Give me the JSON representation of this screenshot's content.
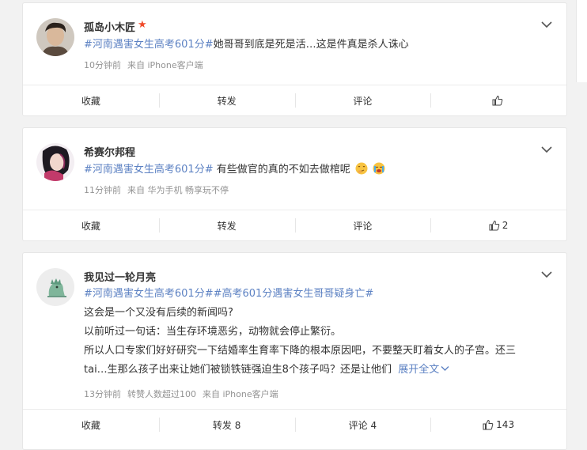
{
  "posts": [
    {
      "username": "孤岛小木匠",
      "text_tag": "#河南遇害女生高考601分#",
      "text_rest": "她哥哥到底是死是活…这是件真是杀人诛心",
      "time": "10分钟前",
      "source": "来自 iPhone客户端",
      "actions": {
        "collect": "收藏",
        "forward": "转发",
        "comment": "评论",
        "like": ""
      }
    },
    {
      "username": "希赛尔邦程",
      "text_tag": "#河南遇害女生高考601分#",
      "text_rest": " 有些做官的真的不如去做棺呢",
      "time": "11分钟前",
      "source": "来自 华为手机 畅享玩不停",
      "actions": {
        "collect": "收藏",
        "forward": "转发",
        "comment": "评论",
        "like": "2"
      }
    },
    {
      "username": "我见过一轮月亮",
      "tag1": "#河南遇害女生高考601分#",
      "tag2": "#高考601分遇害女生哥哥疑身亡#",
      "line1": "这会是一个又没有后续的新闻吗?",
      "line2": "以前听过一句话：当生存环境恶劣，动物就会停止繁衍。",
      "line3": "所以人口专家们好好研究一下结婚率生育率下降的根本原因吧，不要整天盯着女人的子宫。还三",
      "line4": "tai…生那么孩子出来让她们被锁铁链强迫生8个孩子吗？还是让他们",
      "expand": "展开全文",
      "time": "13分钟前",
      "extra": "转赞人数超过100",
      "source": "来自 iPhone客户端",
      "actions": {
        "collect": "收藏",
        "forward": "转发 8",
        "comment": "评论 4",
        "like": "143"
      }
    }
  ],
  "colors": {
    "tag": "#5d82c3",
    "meta": "#939393",
    "vip": "#f04a2a"
  }
}
